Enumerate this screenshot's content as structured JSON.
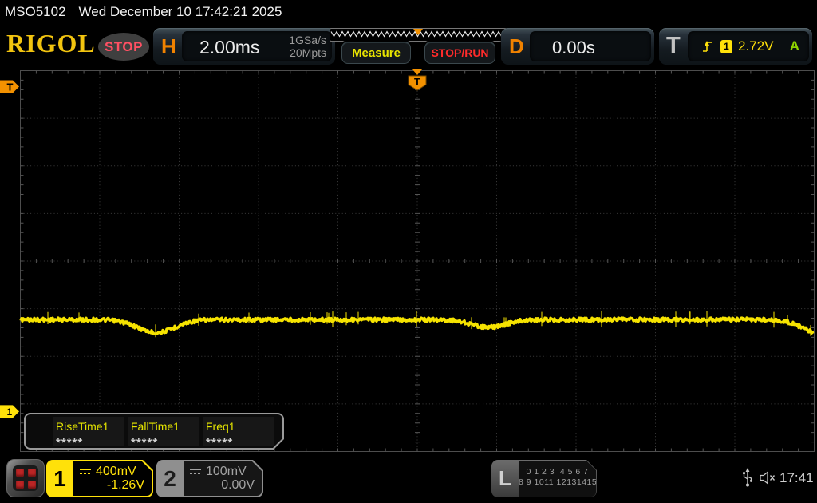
{
  "header": {
    "model": "MSO5102",
    "datetime": "Wed December 10 17:42:21 2025",
    "brand": "RIGOL",
    "acq_status": "STOP",
    "h_label": "H",
    "timebase": "2.00ms",
    "sample_rate": "1GSa/s",
    "mem_depth": "20Mpts",
    "measure_label": "Measure",
    "stoprun_label": "STOP/RUN",
    "d_label": "D",
    "delay": "0.00s",
    "t_label": "T",
    "trigger_source": "1",
    "trigger_level": "2.72V",
    "trigger_mode": "A"
  },
  "markers": {
    "trigger_position_flag": "T",
    "trigger_level_marker": "T",
    "channel1_ground_marker": "1"
  },
  "measurements": {
    "items": [
      {
        "label": "RiseTime1",
        "value": "*****"
      },
      {
        "label": "FallTime1",
        "value": "*****"
      },
      {
        "label": "Freq1",
        "value": "*****"
      }
    ]
  },
  "channels": [
    {
      "id": "1",
      "scale": "400mV",
      "offset": "-1.26V",
      "coupling": "dc",
      "color": "#ffe10a",
      "active": true
    },
    {
      "id": "2",
      "scale": "100mV",
      "offset": "0.00V",
      "coupling": "dc",
      "color": "#9a9a9a",
      "active": false
    }
  ],
  "logic_analyzer": {
    "label": "L",
    "row1": "0 1 2 3  4 5 6 7",
    "row2": "8 9 1011 12131415"
  },
  "statusbar": {
    "clock": "17:41"
  },
  "colors": {
    "accent_orange": "#f39100",
    "channel1_yellow": "#f6e300",
    "trigger_yellow": "#ffe10a",
    "stop_red": "#ff2b2b",
    "sweep_green": "#8fd300",
    "gray_text": "#9a9a9a"
  },
  "chart_data": {
    "type": "line",
    "title": "CH1 analog trace (stopped acquisition)",
    "x_axis": {
      "divisions": 10,
      "time_per_div": "2.00ms",
      "delay": "0.00s"
    },
    "y_axis": {
      "divisions": 8,
      "volts_per_div": "400mV",
      "offset": "-1.26V"
    },
    "grid": "dotted 10x8 with center axes ticks",
    "baseline_y_div": 5.23,
    "noise_pp_div": 0.08,
    "trigger_level_y_div": 0.335,
    "channel1_ground_y_div": 7.16,
    "trigger_position_x_div": 5.0,
    "dips": [
      {
        "center_x_div": 1.71,
        "half_width_div": 0.33,
        "depth_div": 0.27
      },
      {
        "center_x_div": 5.9,
        "half_width_div": 0.3,
        "depth_div": 0.16
      },
      {
        "center_x_div": 10.15,
        "half_width_div": 0.35,
        "depth_div": 0.35
      }
    ]
  }
}
